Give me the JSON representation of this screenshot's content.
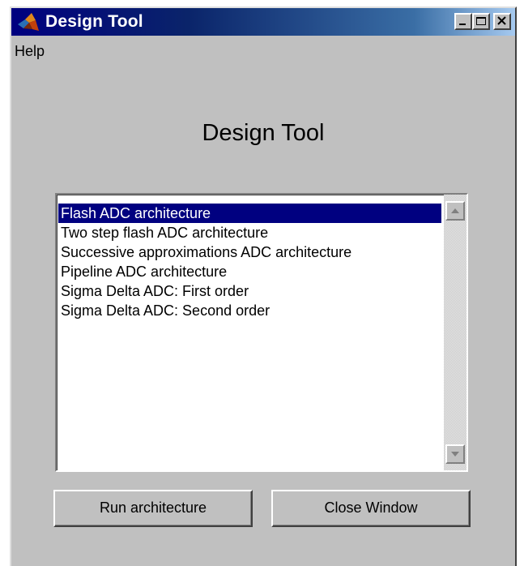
{
  "window": {
    "title": "Design Tool",
    "colors": {
      "titlebar": "#000080",
      "face": "#c0c0c0",
      "selection": "#000080"
    }
  },
  "menu": {
    "help": "Help"
  },
  "heading": "Design Tool",
  "listbox": {
    "items": [
      {
        "label": "Flash ADC architecture",
        "selected": true
      },
      {
        "label": "Two step flash ADC architecture",
        "selected": false
      },
      {
        "label": "Successive approximations ADC architecture",
        "selected": false
      },
      {
        "label": "Pipeline ADC architecture",
        "selected": false
      },
      {
        "label": "Sigma Delta ADC: First order",
        "selected": false
      },
      {
        "label": "Sigma Delta ADC: Second order",
        "selected": false
      }
    ]
  },
  "buttons": {
    "run": "Run architecture",
    "close": "Close Window"
  },
  "icons": {
    "app": "matlab-icon",
    "minimize": "minimize-icon",
    "maximize": "maximize-icon",
    "close": "close-icon",
    "scroll_up": "arrow-up-icon",
    "scroll_down": "arrow-down-icon"
  }
}
